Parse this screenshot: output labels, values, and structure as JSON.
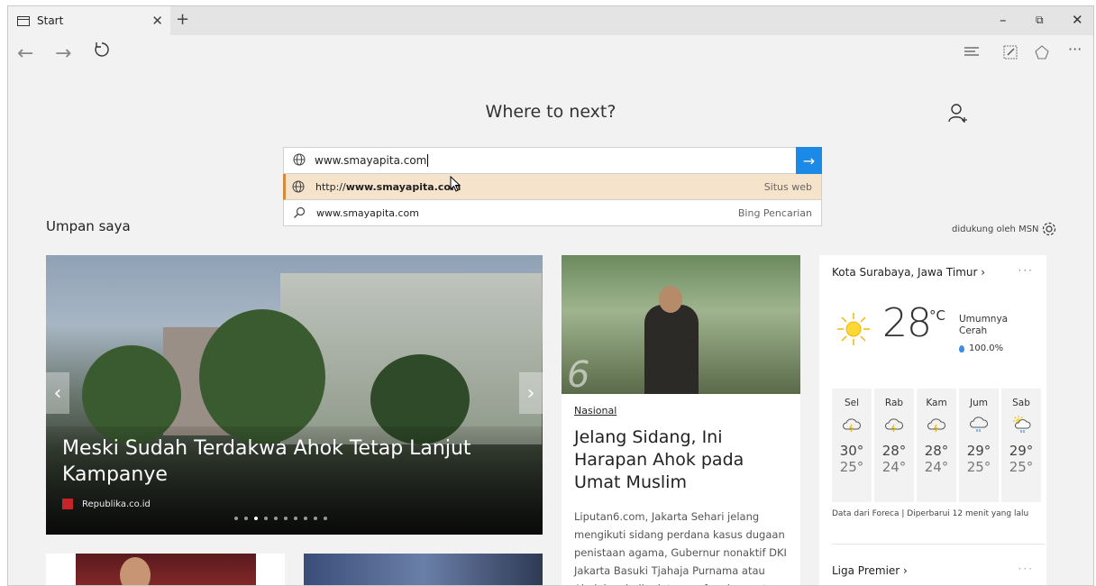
{
  "tab": {
    "title": "Start"
  },
  "main": {
    "heading": "Where to next?",
    "search": {
      "value": "www.smayapita.com"
    },
    "suggestions": [
      {
        "prefix": "http://",
        "bold": "www.smayapita.com",
        "type": "Situs web"
      },
      {
        "text": "www.smayapita.com",
        "type": "Bing Pencarian"
      }
    ],
    "feed_title": "Umpan saya",
    "powered_by": "didukung oleh MSN"
  },
  "hero": {
    "title": "Meski Sudah Terdakwa Ahok Tetap Lanjut Kampanye",
    "source": "Republika.co.id",
    "slides": 10,
    "active_slide": 3
  },
  "article": {
    "category": "Nasional",
    "title": "Jelang Sidang, Ini Harapan Ahok pada Umat Muslim",
    "snippet": "Liputan6.com, Jakarta Sehari jelang mengikuti sidang perdana kasus dugaan penistaan agama, Gubernur nonaktif DKI Jakarta Basuki Tjahaja Purnama atau Ahok kembali minta maaf pada umat"
  },
  "weather": {
    "location": "Kota Surabaya, Jawa Timur",
    "temp": "28",
    "unit": "°C",
    "condition": "Umumnya Cerah",
    "humidity": "100.0%",
    "forecast": [
      {
        "day": "Sel",
        "hi": "30°",
        "lo": "25°",
        "icon": "thunder-cloud-icon"
      },
      {
        "day": "Rab",
        "hi": "28°",
        "lo": "24°",
        "icon": "thunder-cloud-icon"
      },
      {
        "day": "Kam",
        "hi": "28°",
        "lo": "24°",
        "icon": "thunder-cloud-icon"
      },
      {
        "day": "Jum",
        "hi": "29°",
        "lo": "25°",
        "icon": "rain-cloud-icon"
      },
      {
        "day": "Sab",
        "hi": "29°",
        "lo": "25°",
        "icon": "sun-rain-icon"
      }
    ],
    "data_note": "Data dari Foreca | Diperbarui 12 menit yang lalu"
  },
  "league": {
    "title": "Liga Premier"
  },
  "colors": {
    "accent": "#1b89e6",
    "suggestion_highlight": "#f6e3cc",
    "suggestion_bar": "#d38a3a"
  }
}
